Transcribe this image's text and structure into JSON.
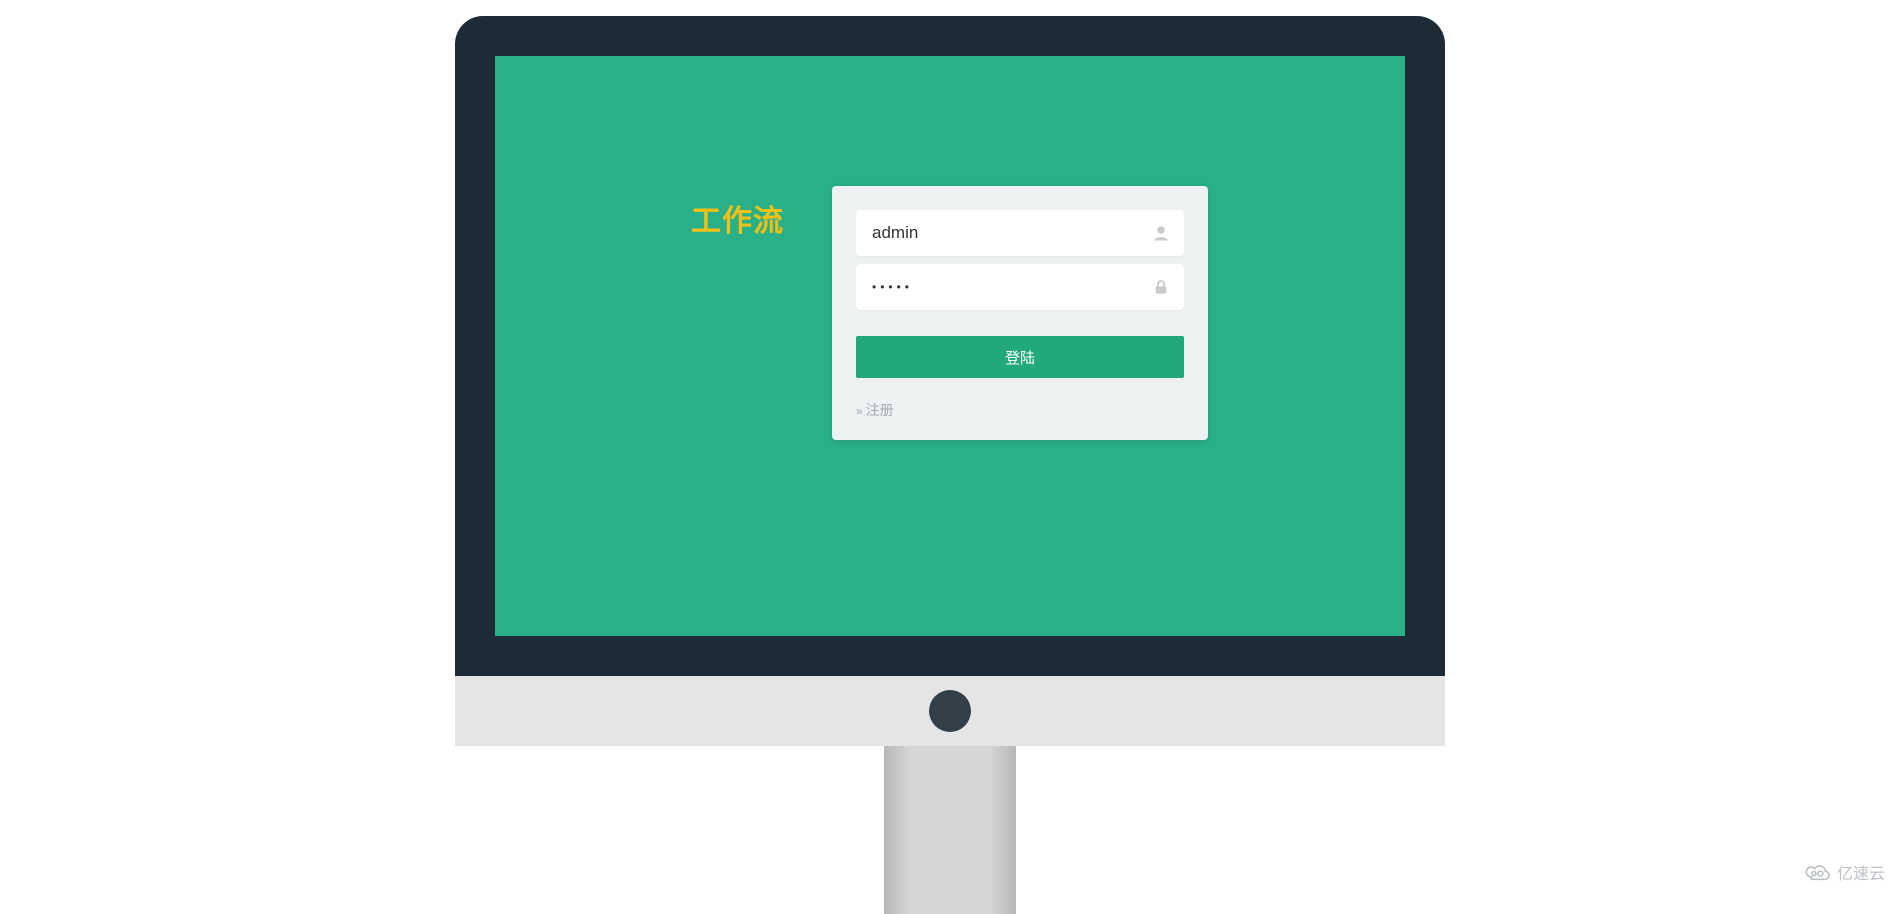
{
  "app": {
    "title": "工作流"
  },
  "login": {
    "username_value": "admin",
    "password_value": "•••••",
    "submit_label": "登陆",
    "register_label": "注册"
  },
  "watermark": {
    "text": "亿速云"
  },
  "icons": {
    "user": "user-icon",
    "lock": "lock-icon",
    "cloud": "cloud-icon"
  }
}
